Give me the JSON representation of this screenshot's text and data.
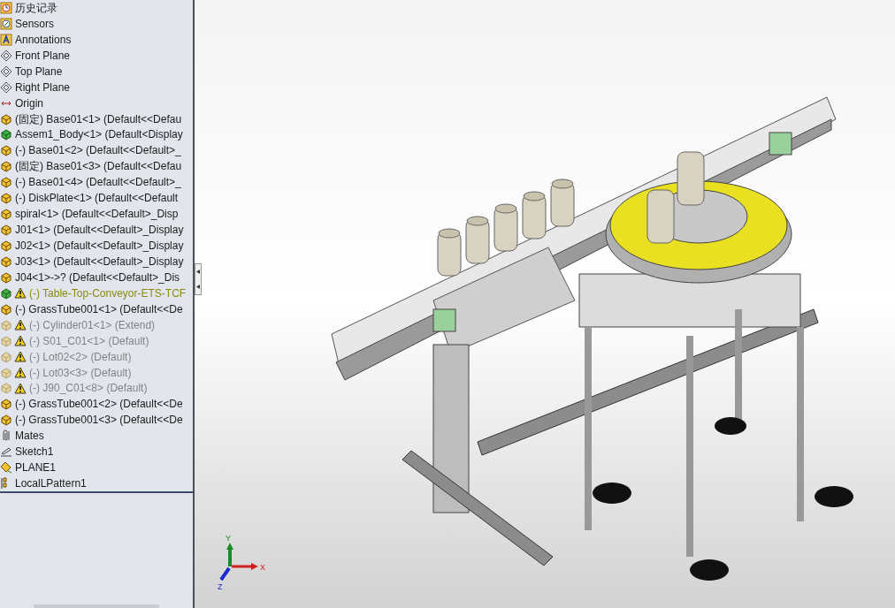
{
  "tree": {
    "items": [
      {
        "kind": "history",
        "label": "历史记录",
        "warning": false,
        "suppressed": false,
        "lightweight": false
      },
      {
        "kind": "sensor",
        "label": "Sensors",
        "warning": false,
        "suppressed": false,
        "lightweight": false
      },
      {
        "kind": "annotation",
        "label": "Annotations",
        "warning": false,
        "suppressed": false,
        "lightweight": false
      },
      {
        "kind": "plane",
        "label": "Front Plane",
        "warning": false,
        "suppressed": false,
        "lightweight": false
      },
      {
        "kind": "plane",
        "label": "Top Plane",
        "warning": false,
        "suppressed": false,
        "lightweight": false
      },
      {
        "kind": "plane",
        "label": "Right Plane",
        "warning": false,
        "suppressed": false,
        "lightweight": false
      },
      {
        "kind": "origin",
        "label": "Origin",
        "warning": false,
        "suppressed": false,
        "lightweight": false
      },
      {
        "kind": "part",
        "label": "(固定) Base01<1> (Default<<Defau",
        "warning": false,
        "suppressed": false,
        "lightweight": false
      },
      {
        "kind": "body",
        "label": "Assem1_Body<1> (Default<Display",
        "warning": false,
        "suppressed": false,
        "lightweight": false
      },
      {
        "kind": "part",
        "label": "(-) Base01<2> (Default<<Default>_",
        "warning": false,
        "suppressed": false,
        "lightweight": false
      },
      {
        "kind": "part",
        "label": "(固定) Base01<3> (Default<<Defau",
        "warning": false,
        "suppressed": false,
        "lightweight": false
      },
      {
        "kind": "part",
        "label": "(-) Base01<4> (Default<<Default>_",
        "warning": false,
        "suppressed": false,
        "lightweight": false
      },
      {
        "kind": "part",
        "label": "(-) DiskPlate<1> (Default<<Default",
        "warning": false,
        "suppressed": false,
        "lightweight": false
      },
      {
        "kind": "part",
        "label": "spiral<1> (Default<<Default>_Disp",
        "warning": false,
        "suppressed": false,
        "lightweight": false
      },
      {
        "kind": "part",
        "label": "J01<1> (Default<<Default>_Display",
        "warning": false,
        "suppressed": false,
        "lightweight": false
      },
      {
        "kind": "part",
        "label": "J02<1> (Default<<Default>_Display",
        "warning": false,
        "suppressed": false,
        "lightweight": false
      },
      {
        "kind": "part",
        "label": "J03<1> (Default<<Default>_Display",
        "warning": false,
        "suppressed": false,
        "lightweight": false
      },
      {
        "kind": "part",
        "label": "J04<1>->? (Default<<Default>_Dis",
        "warning": false,
        "suppressed": false,
        "lightweight": false
      },
      {
        "kind": "body",
        "label": "(-) Table-Top-Conveyor-ETS-TCF",
        "warning": true,
        "suppressed": false,
        "lightweight": true
      },
      {
        "kind": "part",
        "label": "(-) GrassTube001<1> (Default<<De",
        "warning": false,
        "suppressed": false,
        "lightweight": false
      },
      {
        "kind": "part",
        "label": "(-) Cylinder01<1> (Extend)",
        "warning": true,
        "suppressed": true,
        "lightweight": false
      },
      {
        "kind": "part",
        "label": "(-) S01_C01<1> (Default)",
        "warning": true,
        "suppressed": true,
        "lightweight": false
      },
      {
        "kind": "part",
        "label": "(-) Lot02<2> (Default)",
        "warning": true,
        "suppressed": true,
        "lightweight": false
      },
      {
        "kind": "part",
        "label": "(-) Lot03<3> (Default)",
        "warning": true,
        "suppressed": true,
        "lightweight": false
      },
      {
        "kind": "part",
        "label": "(-) J90_C01<8> (Default)",
        "warning": true,
        "suppressed": true,
        "lightweight": false
      },
      {
        "kind": "part",
        "label": "(-) GrassTube001<2> (Default<<De",
        "warning": false,
        "suppressed": false,
        "lightweight": false
      },
      {
        "kind": "part",
        "label": "(-) GrassTube001<3> (Default<<De",
        "warning": false,
        "suppressed": false,
        "lightweight": false
      },
      {
        "kind": "mates",
        "label": "Mates",
        "warning": false,
        "suppressed": false,
        "lightweight": false
      },
      {
        "kind": "sketch",
        "label": "Sketch1",
        "warning": false,
        "suppressed": false,
        "lightweight": false
      },
      {
        "kind": "refplane",
        "label": "PLANE1",
        "warning": false,
        "suppressed": false,
        "lightweight": false
      },
      {
        "kind": "pattern",
        "label": "LocalLPattern1",
        "warning": false,
        "suppressed": false,
        "lightweight": false
      }
    ]
  },
  "triad_labels": {
    "x": "X",
    "y": "Y",
    "z": "Z"
  }
}
